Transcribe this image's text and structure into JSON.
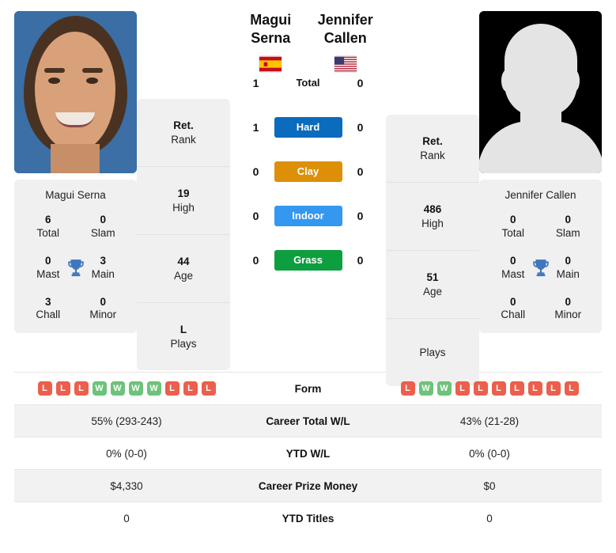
{
  "players": {
    "left": {
      "name": "Magui Serna",
      "flag": "spain-flag",
      "photo": "player-photo",
      "titles": {
        "card_name": "Magui Serna",
        "cells": [
          {
            "value": "6",
            "label": "Total"
          },
          {
            "value": "0",
            "label": "Slam"
          },
          {
            "value": "0",
            "label": "Mast"
          },
          {
            "value": "3",
            "label": "Main"
          },
          {
            "value": "3",
            "label": "Chall"
          },
          {
            "value": "0",
            "label": "Minor"
          }
        ]
      },
      "info": [
        {
          "value": "Ret.",
          "label": "Rank"
        },
        {
          "value": "19",
          "label": "High"
        },
        {
          "value": "44",
          "label": "Age"
        },
        {
          "value": "L",
          "label": "Plays"
        }
      ]
    },
    "right": {
      "name": "Jennifer Callen",
      "name_line1": "Jennifer",
      "name_line2": "Callen",
      "flag": "usa-flag",
      "photo": "player-photo-placeholder",
      "titles": {
        "card_name": "Jennifer Callen",
        "cells": [
          {
            "value": "0",
            "label": "Total"
          },
          {
            "value": "0",
            "label": "Slam"
          },
          {
            "value": "0",
            "label": "Mast"
          },
          {
            "value": "0",
            "label": "Main"
          },
          {
            "value": "0",
            "label": "Chall"
          },
          {
            "value": "0",
            "label": "Minor"
          }
        ]
      },
      "info": [
        {
          "value": "Ret.",
          "label": "Rank"
        },
        {
          "value": "486",
          "label": "High"
        },
        {
          "value": "51",
          "label": "Age"
        },
        {
          "value": "",
          "label": "Plays"
        }
      ]
    }
  },
  "head_to_head": [
    {
      "surface": "Total",
      "left": "1",
      "right": "0",
      "color": "transparent",
      "plain": true
    },
    {
      "surface": "Hard",
      "left": "1",
      "right": "0",
      "color": "#0b6bbd",
      "plain": false
    },
    {
      "surface": "Clay",
      "left": "0",
      "right": "0",
      "color": "#dd9007",
      "plain": false
    },
    {
      "surface": "Indoor",
      "left": "0",
      "right": "0",
      "color": "#3498f0",
      "plain": false
    },
    {
      "surface": "Grass",
      "left": "0",
      "right": "0",
      "color": "#0d9f3f",
      "plain": false
    }
  ],
  "stats_rows": [
    {
      "label": "Form",
      "type": "form",
      "left_form": [
        "L",
        "L",
        "L",
        "W",
        "W",
        "W",
        "W",
        "L",
        "L",
        "L"
      ],
      "right_form": [
        "L",
        "W",
        "W",
        "L",
        "L",
        "L",
        "L",
        "L",
        "L",
        "L"
      ]
    },
    {
      "label": "Career Total W/L",
      "type": "text",
      "left": "55% (293-243)",
      "right": "43% (21-28)"
    },
    {
      "label": "YTD W/L",
      "type": "text",
      "left": "0% (0-0)",
      "right": "0% (0-0)"
    },
    {
      "label": "Career Prize Money",
      "type": "text",
      "left": "$4,330",
      "right": "$0"
    },
    {
      "label": "YTD Titles",
      "type": "text",
      "left": "0",
      "right": "0"
    }
  ],
  "colors": {
    "hard": "#0b6bbd",
    "clay": "#dd9007",
    "indoor": "#3498f0",
    "grass": "#0d9f3f",
    "win": "#6cc379",
    "loss": "#ec5f4c",
    "card_bg": "#f0f0f0"
  }
}
